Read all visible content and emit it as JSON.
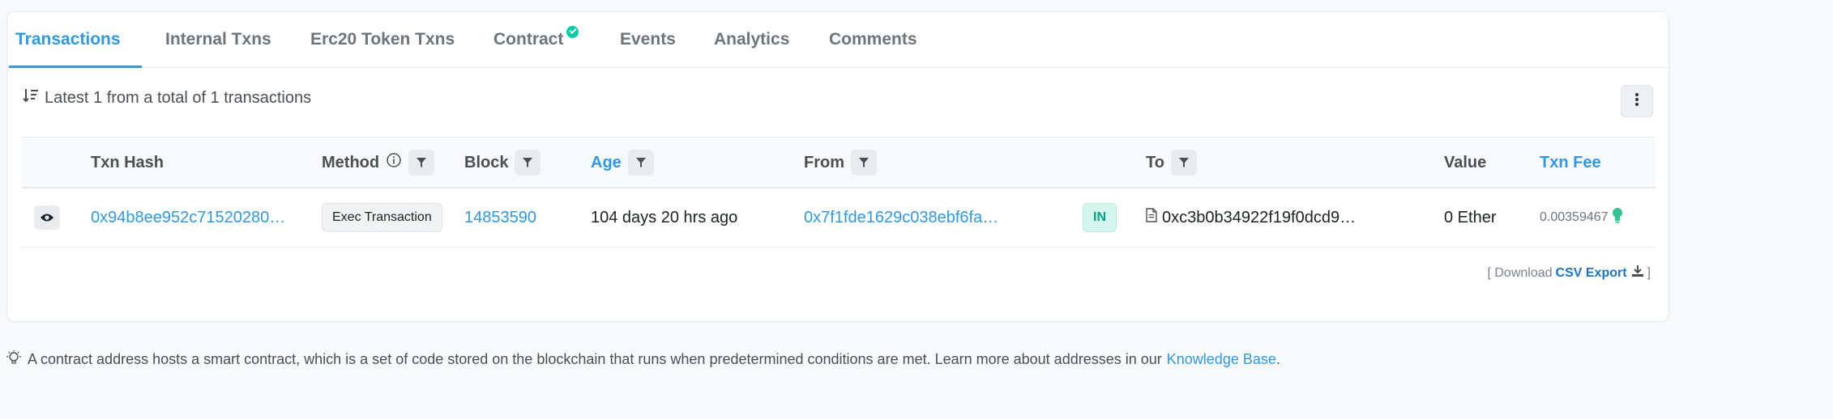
{
  "tabs": [
    {
      "label": "Transactions",
      "active": true
    },
    {
      "label": "Internal Txns"
    },
    {
      "label": "Erc20 Token Txns"
    },
    {
      "label": "Contract",
      "verified": true
    },
    {
      "label": "Events"
    },
    {
      "label": "Analytics"
    },
    {
      "label": "Comments"
    }
  ],
  "summary": {
    "text": "Latest 1 from a total of 1 transactions"
  },
  "table": {
    "headers": {
      "txn_hash": "Txn Hash",
      "method": "Method",
      "block": "Block",
      "age": "Age",
      "from": "From",
      "to": "To",
      "value": "Value",
      "txn_fee": "Txn Fee"
    },
    "rows": [
      {
        "txn_hash": "0x94b8ee952c71520280…",
        "method": "Exec Transaction",
        "block": "14853590",
        "age": "104 days 20 hrs ago",
        "from": "0x7f1fde1629c038ebf6fa…",
        "direction": "IN",
        "to": "0xc3b0b34922f19f0dcd9…",
        "value": "0 Ether",
        "txn_fee": "0.00359467"
      }
    ]
  },
  "export": {
    "prefix": "[ Download",
    "link": "CSV Export",
    "suffix": "]"
  },
  "footnote": {
    "text": "A contract address hosts a smart contract, which is a set of code stored on the blockchain that runs when predetermined conditions are met. Learn more about addresses in our",
    "link": "Knowledge Base",
    "end": "."
  },
  "colors": {
    "accent": "#3498db",
    "success": "#00c9a7",
    "in_badge_bg": "#d6f5ec",
    "text": "#1e2022",
    "muted": "#6c757d"
  },
  "icons": [
    "sort-desc-icon",
    "kebab-menu-icon",
    "info-icon",
    "filter-icon",
    "eye-icon",
    "document-icon",
    "lightbulb-icon",
    "download-icon",
    "check-circle-icon"
  ]
}
